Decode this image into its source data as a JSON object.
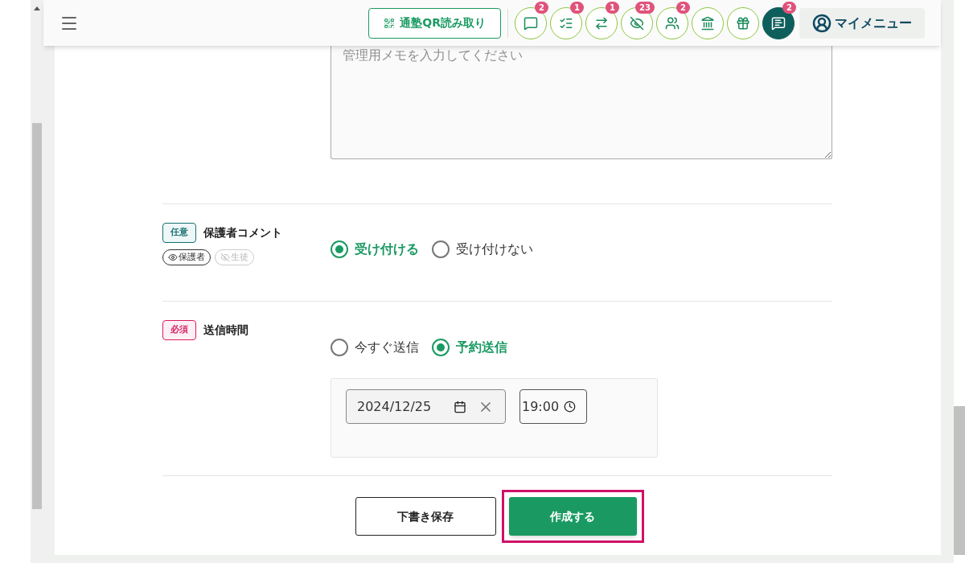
{
  "header": {
    "qr_button": "通塾QR読み取り",
    "icon_buttons": [
      {
        "badge": "2",
        "filled": false
      },
      {
        "badge": "1",
        "filled": false
      },
      {
        "badge": "1",
        "filled": false
      },
      {
        "badge": "23",
        "filled": false
      },
      {
        "badge": "2",
        "filled": false
      },
      {
        "filled": false
      },
      {
        "filled": false
      },
      {
        "badge": "2",
        "filled": true
      }
    ],
    "menu_button": "マイメニュー"
  },
  "memo": {
    "placeholder": "管理用メモを入力してください"
  },
  "fields": [
    {
      "kind": "radio",
      "tag": {
        "label": "任意",
        "required": false
      },
      "label": "保護者コメント",
      "visibility": [
        {
          "label": "保護者",
          "visible": true
        },
        {
          "label": "生徒",
          "visible": false
        }
      ],
      "options": [
        {
          "label": "受け付ける",
          "selected": true
        },
        {
          "label": "受け付けない",
          "selected": false
        }
      ]
    },
    {
      "kind": "schedule",
      "tag": {
        "label": "必須",
        "required": true
      },
      "label": "送信時間",
      "options": [
        {
          "label": "今すぐ送信",
          "selected": false
        },
        {
          "label": "予約送信",
          "selected": true
        }
      ],
      "date": "2024/12/25",
      "time": "19:00"
    }
  ],
  "buttons": {
    "draft": "下書き保存",
    "create": "作成する",
    "create_highlighted": true
  }
}
